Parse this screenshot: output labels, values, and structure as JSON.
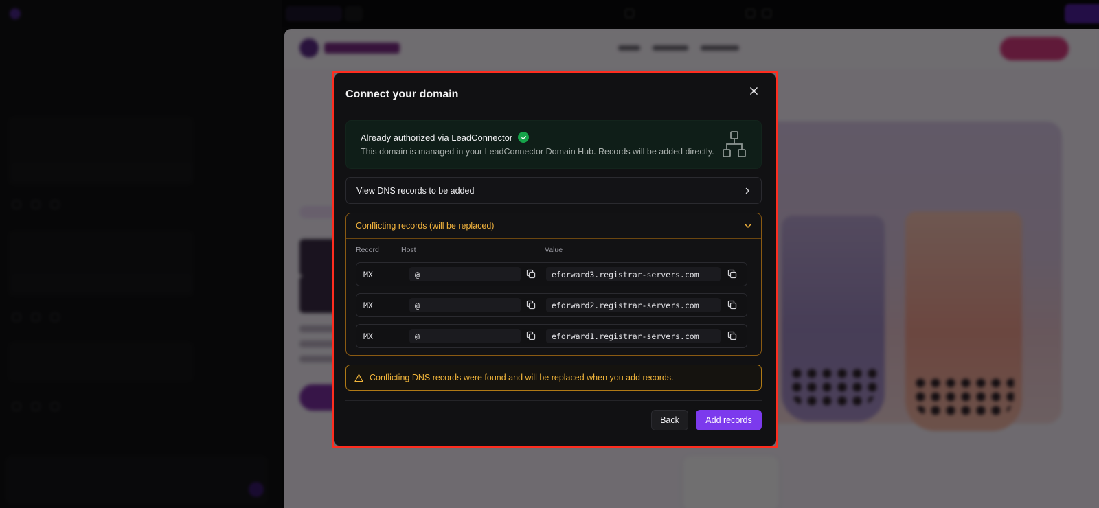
{
  "modal": {
    "title": "Connect your domain",
    "auth": {
      "title": "Already authorized via LeadConnector",
      "description": "This domain is managed in your LeadConnector Domain Hub. Records will be added directly."
    },
    "view_dns_label": "View DNS records to be added",
    "conflict": {
      "title": "Conflicting records (will be replaced)",
      "columns": [
        "Record",
        "Host",
        "Value"
      ],
      "records": [
        {
          "type": "MX",
          "host": "@",
          "value": "eforward3.registrar-servers.com"
        },
        {
          "type": "MX",
          "host": "@",
          "value": "eforward2.registrar-servers.com"
        },
        {
          "type": "MX",
          "host": "@",
          "value": "eforward1.registrar-servers.com"
        }
      ]
    },
    "warning": "Conflicting DNS records were found and will be replaced when you add records.",
    "buttons": {
      "back": "Back",
      "add": "Add records"
    }
  },
  "colors": {
    "accent": "#7c3aed",
    "success": "#16a34a",
    "warning": "#f0b43a",
    "highlight_border": "#ff2d1f"
  }
}
